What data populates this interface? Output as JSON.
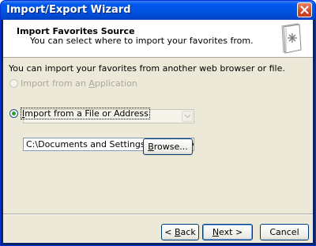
{
  "window": {
    "title": "Import/Export Wizard"
  },
  "header": {
    "title": "Import Favorites Source",
    "subtitle": "You can select where to import your favorites from."
  },
  "intro_text": "You can import your favorites from another web browser or file.",
  "options": {
    "application": {
      "label_prefix": "Import from an ",
      "label_accel": "A",
      "label_suffix": "pplication",
      "selected": false,
      "enabled": false,
      "combo_value": ""
    },
    "file": {
      "label_prefix": "",
      "label_accel": "I",
      "label_suffix": "mport from a File or Address",
      "selected": true,
      "enabled": true,
      "path_value": "C:\\Documents and Settings\\coliope\\My Documents\\bo"
    }
  },
  "buttons": {
    "browse": {
      "label_prefix": "",
      "label_accel": "B",
      "label_suffix": "rowse..."
    },
    "back": {
      "arrow": "<",
      "label_prefix": " ",
      "label_accel": "B",
      "label_suffix": "ack"
    },
    "next": {
      "label_prefix": "",
      "label_accel": "N",
      "label_suffix": "ext",
      "arrow": ">"
    },
    "cancel": {
      "label": "Cancel"
    }
  },
  "icons": {
    "close": "close-icon",
    "wizard": "bookmark-star-icon"
  },
  "colors": {
    "title_bar": "#0054e3",
    "close_button": "#d2492a",
    "face": "#ece9d8",
    "radio_dot": "#21a121"
  }
}
